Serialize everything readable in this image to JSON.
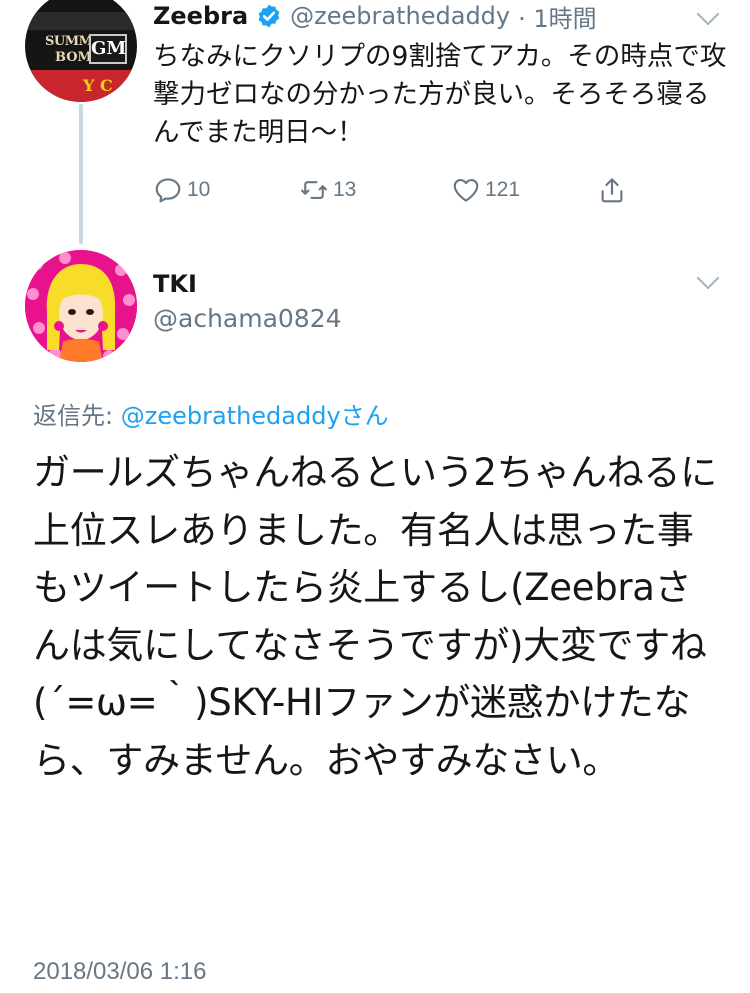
{
  "colors": {
    "accent": "#1da1f2",
    "text": "#14171a",
    "secondary": "#657786",
    "thread_line": "#ccd6dd"
  },
  "tweet1": {
    "author_name": "Zeebra",
    "verified_icon": "verified-badge-icon",
    "handle": "@zeebrathedaddy",
    "time": "· 1時間",
    "text": "ちなみにクソリプの9割捨てアカ。その時点で攻撃力ゼロなの分かった方が良い。そろそろ寝るんでまた明日〜！",
    "avatar_logo": {
      "line1": "SUMMER",
      "line2": "BOMB",
      "badge": "GM"
    },
    "actions": {
      "reply": {
        "icon": "reply-icon",
        "count": "10"
      },
      "retweet": {
        "icon": "retweet-icon",
        "count": "13"
      },
      "like": {
        "icon": "heart-icon",
        "count": "121"
      },
      "share": {
        "icon": "share-icon"
      }
    }
  },
  "tweet2": {
    "author_name": "TKI",
    "handle": "@achama0824",
    "reply_label": "返信先: ",
    "reply_mention": "@zeebrathedaddyさん",
    "text": "ガールズちゃんねるという2ちゃんねるに上位スレありました。有名人は思った事もツイートしたら炎上するし(Zeebraさんは気にしてなさそうですが)大変ですね(´=ω=｀)SKY-HIファンが迷惑かけたなら、すみません。おやすみなさい。",
    "timestamp": "2018/03/06 1:16"
  }
}
